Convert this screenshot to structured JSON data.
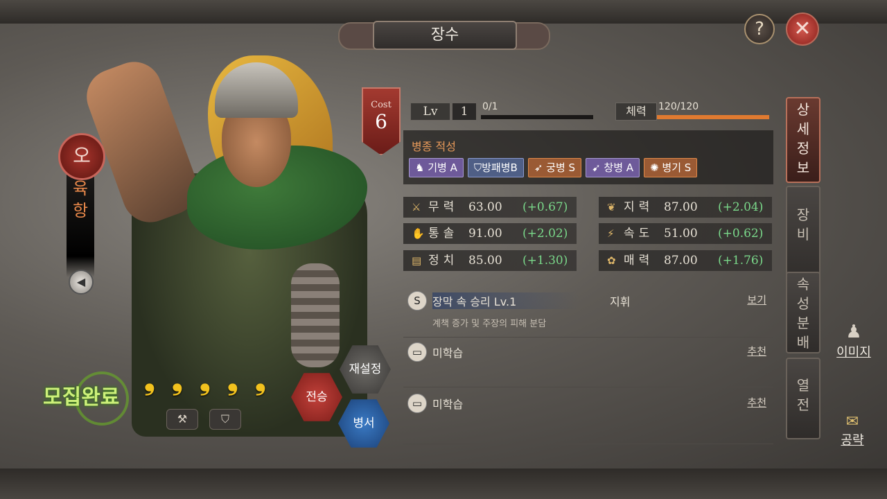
{
  "title": "장수",
  "header": {
    "help_label": "?",
    "close_label": "✕"
  },
  "general": {
    "seal": "오",
    "name_chars": [
      "육",
      "항"
    ],
    "cost_label": "Cost",
    "cost_value": "6",
    "recruit_status": "모집완료",
    "star_count": 5
  },
  "actions": {
    "reset": "재설정",
    "inherit": "전승",
    "book": "병서"
  },
  "level": {
    "label": "Lv",
    "value": "1",
    "exp": "0/1",
    "exp_progress": 0.0
  },
  "stamina": {
    "label": "체력",
    "value": "120/120",
    "progress": 1.0
  },
  "aptitude": {
    "title": "병종 적성",
    "items": [
      {
        "label": "기병 A",
        "color": "purple"
      },
      {
        "label": "방패병B",
        "color": "blue"
      },
      {
        "label": "궁병 S",
        "color": "orange"
      },
      {
        "label": "창병 A",
        "color": "purple"
      },
      {
        "label": "병기 S",
        "color": "orange"
      }
    ]
  },
  "stats": [
    {
      "name": "무력",
      "value": "63.00",
      "bonus": "(+0.67)"
    },
    {
      "name": "지력",
      "value": "87.00",
      "bonus": "(+2.04)"
    },
    {
      "name": "통솔",
      "value": "91.00",
      "bonus": "(+2.02)"
    },
    {
      "name": "속도",
      "value": "51.00",
      "bonus": "(+0.62)"
    },
    {
      "name": "정치",
      "value": "85.00",
      "bonus": "(+1.30)"
    },
    {
      "name": "매력",
      "value": "87.00",
      "bonus": "(+1.76)"
    }
  ],
  "skills": [
    {
      "icon": "S",
      "name": "장막 속 승리 Lv.1",
      "type": "지휘",
      "link": "보기",
      "desc": "계책 증가 및 주장의 피해 분담"
    },
    {
      "icon": "▭",
      "name": "미학습",
      "type": "",
      "link": "추천",
      "desc": ""
    },
    {
      "icon": "▭",
      "name": "미학습",
      "type": "",
      "link": "추천",
      "desc": ""
    }
  ],
  "tabs": [
    "상세정보",
    "장비",
    "속성분배",
    "열전"
  ],
  "side": {
    "image_label": "이미지",
    "guide_label": "공략"
  }
}
